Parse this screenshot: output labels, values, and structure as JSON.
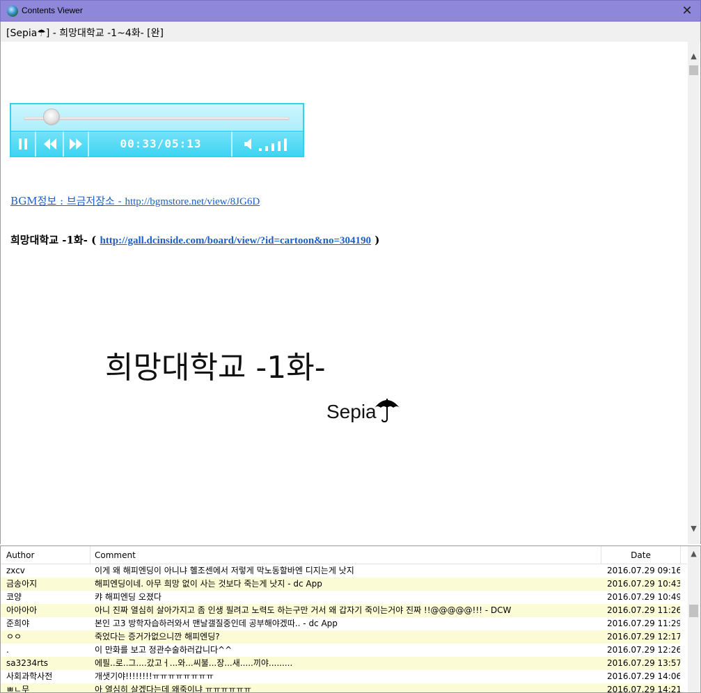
{
  "window": {
    "title": "Contents Viewer",
    "close_glyph": "✕",
    "icon": "globe-icon"
  },
  "subtitle": "[Sepia☂]  -   희망대학교 -1~4화- [완]",
  "player": {
    "time": "00:33/05:13",
    "progress": 0.105,
    "volume_bars": 5,
    "accent_color": "#3fd4f4"
  },
  "content": {
    "bgm_label": "BGM정보 : 브금저장소 - ",
    "bgm_url": "http://bgmstore.net/view/8JG6D",
    "episode_prefix": "희망대학교 -1화- ( ",
    "episode_url": "http://gall.dcinside.com/board/view/?id=cartoon&no=304190",
    "episode_suffix": " )",
    "big_title": "희망대학교  -1화-",
    "signature": "Sepia"
  },
  "comments": {
    "headers": {
      "author": "Author",
      "comment": "Comment",
      "date": "Date"
    },
    "rows": [
      {
        "author": "zxcv",
        "comment": "이게 왜 해피엔딩이 아니냐 혤조센에서 저렇게 막노동할바엔 디지는게 낫지",
        "date": "2016.07.29 09:16"
      },
      {
        "author": "금송아지",
        "comment": "해피엔딩이네. 아무 희망 없이 사는 것보다 죽는게 낫지  - dc App",
        "date": "2016.07.29 10:43"
      },
      {
        "author": "코양",
        "comment": "캬 해피엔딩 오졌다",
        "date": "2016.07.29 10:49"
      },
      {
        "author": "아아아아",
        "comment": "아니 진짜 열심히 살아가지고 좀 인생 필려고 노력도 하는구만 거서 왜 갑자기 죽이는거야 진짜 !!@@@@@!!! - DCW",
        "date": "2016.07.29 11:26"
      },
      {
        "author": "준희야",
        "comment": "본인 고3 방학자습하러와서 맨날갤질중인데 공부해야겠따..  - dc App",
        "date": "2016.07.29 11:29"
      },
      {
        "author": "ㅇㅇ",
        "comment": "죽었다는 증거가없으니깐 해피엔딩?",
        "date": "2016.07.29 12:17"
      },
      {
        "author": ".",
        "comment": "이 만화를 보고 정관수술하러갑니다^^",
        "date": "2016.07.29 12:26"
      },
      {
        "author": "sa3234rts",
        "comment": "에필..로..그....갔고ㅓ...와...씨불...장...새.....끼야.........",
        "date": "2016.07.29 13:57"
      },
      {
        "author": "사회과학사전",
        "comment": "개샛기야!!!!!!!!ㅠㅠㅠㅠㅠㅠㅠㅠ",
        "date": "2016.07.29 14:06"
      },
      {
        "author": "ㅃㄴ무",
        "comment": "아 열심히 살겠다는데 왜죽이냐 ㅠㅠㅠㅠㅠㅠ",
        "date": "2016.07.29 14:21"
      }
    ]
  }
}
